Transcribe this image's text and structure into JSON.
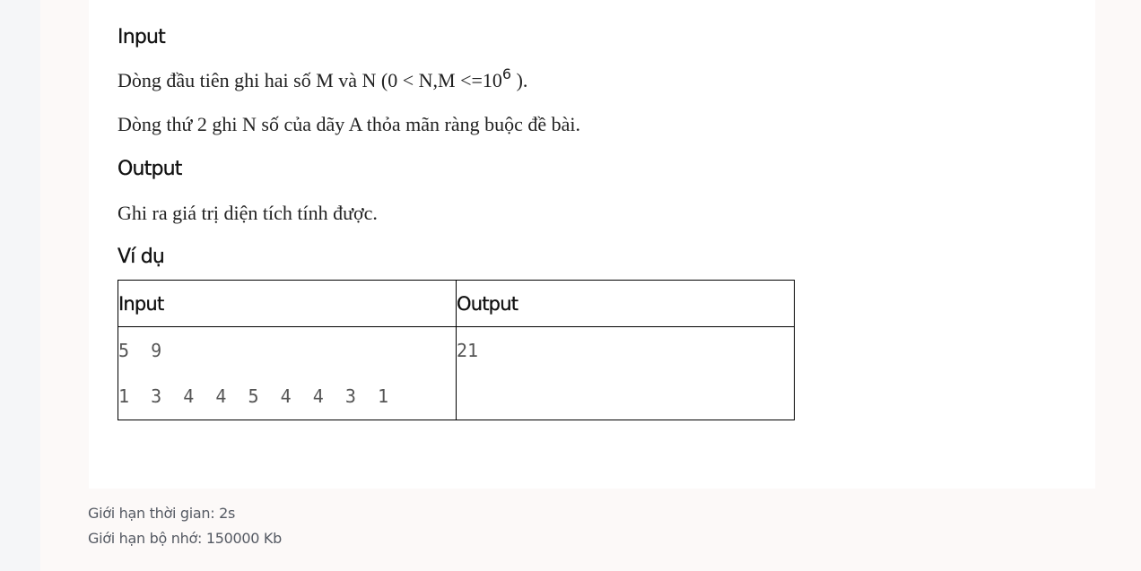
{
  "problem": {
    "input_heading": "Input",
    "input_line1": "Dòng đầu tiên ghi hai số M và N (0 < N,M <=10",
    "input_line1_exponent": "6",
    "input_line1_end": " ).",
    "input_line2": "Dòng thứ 2 ghi N số của dãy A thỏa mãn ràng buộc đề bài.",
    "output_heading": "Output",
    "output_line1": "Ghi ra giá trị diện tích tính được.",
    "example_heading": "Ví dụ",
    "example_table": {
      "headers": [
        "Input",
        "Output"
      ],
      "input_lines": [
        "5 9",
        "1 3 4 4 5 4 4 3 1"
      ],
      "output_lines": [
        "21"
      ]
    }
  },
  "limits": {
    "time": "Giới hạn thời gian: 2s",
    "memory": "Giới hạn bộ nhớ: 150000 Kb"
  }
}
